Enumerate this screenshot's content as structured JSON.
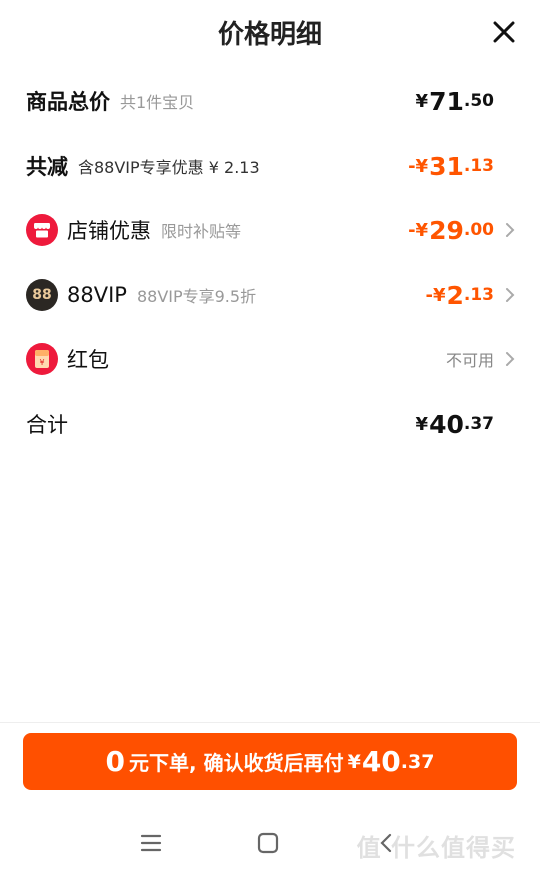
{
  "title": "价格明细",
  "rows": {
    "total": {
      "label": "商品总价",
      "sub": "共1件宝贝",
      "currency": "¥",
      "int": "71",
      "dec": ".50"
    },
    "reduce": {
      "label": "共减",
      "sub": "含88VIP专享优惠 ¥ 2.13",
      "currency": "-¥",
      "int": "31",
      "dec": ".13"
    },
    "shop": {
      "label": "店铺优惠",
      "sub": "限时补贴等",
      "currency": "-¥",
      "int": "29",
      "dec": ".00"
    },
    "vip": {
      "label": "88VIP",
      "sub": "88VIP专享9.5折",
      "currency": "-¥",
      "int": "2",
      "dec": ".13",
      "badge": "88"
    },
    "redpacket": {
      "label": "红包",
      "status": "不可用"
    },
    "sum": {
      "label": "合计",
      "currency": "¥",
      "int": "40",
      "dec": ".37"
    }
  },
  "cta": {
    "zero": "0",
    "text": "元下单, 确认收货后再付",
    "currency": "¥",
    "int": "40",
    "dec": ".37"
  },
  "watermark": "值 什么值得买",
  "colors": {
    "accent": "#ff5000",
    "red_text": "#ff5500",
    "shop_icon": "#ee1a3c",
    "vip_icon": "#2b2723"
  },
  "icons": [
    "close-icon",
    "shop-icon",
    "vip-88-icon",
    "redpacket-icon",
    "chevron-right-icon",
    "menu-icon",
    "home-icon",
    "back-icon"
  ]
}
